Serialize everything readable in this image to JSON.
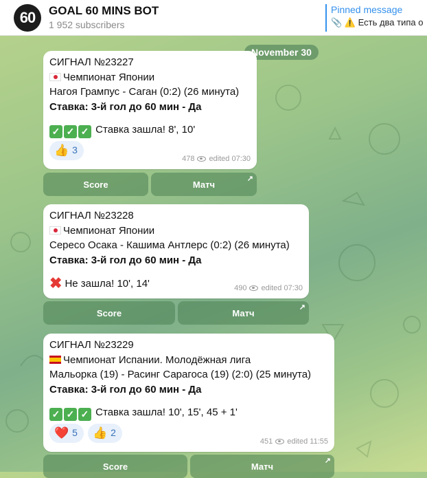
{
  "header": {
    "avatar_text": "60",
    "title": "GOAL 60 MINS BOT",
    "subscribers": "1 952 subscribers",
    "pinned_label": "Pinned message",
    "pinned_preview": "📎 ⚠️ Есть два типа о"
  },
  "date_label": "November 30",
  "messages": [
    {
      "title": "СИГНАЛ №23227",
      "league": "Чемпионат Японии",
      "flag": "jp",
      "match": "Нагоя Грампус - Саган (0:2) (26 минута)",
      "bet": "Ставка: 3-й гол до 60 мин - Да",
      "result_icon": "check-x3",
      "result": "Ставка зашла! 8', 10'",
      "reactions": [
        {
          "icon": "👍",
          "count": "3"
        }
      ],
      "views": "478",
      "edited": "edited 07:30",
      "buttons": {
        "score": "Score",
        "match": "Матч"
      }
    },
    {
      "title": "СИГНАЛ №23228",
      "league": "Чемпионат Японии",
      "flag": "jp",
      "match": "Сересо Осака - Кашима Антлерс (0:2) (26 минута)",
      "bet": "Ставка: 3-й гол до 60 мин - Да",
      "result_icon": "cross",
      "result": "Не зашла! 10', 14'",
      "reactions": [],
      "views": "490",
      "edited": "edited 07:30",
      "buttons": {
        "score": "Score",
        "match": "Матч"
      }
    },
    {
      "title": "СИГНАЛ №23229",
      "league": "Чемпионат Испании. Молодёжная лига",
      "flag": "es",
      "match": "Мальорка (19) - Расинг Сарагоса (19) (2:0) (25 минута)",
      "bet": "Ставка: 3-й гол до 60 мин - Да",
      "result_icon": "check-x3",
      "result": "Ставка зашла! 10', 15', 45 + 1'",
      "reactions": [
        {
          "icon": "❤️",
          "count": "5"
        },
        {
          "icon": "👍",
          "count": "2"
        }
      ],
      "views": "451",
      "edited": "edited 11:55",
      "buttons": {
        "score": "Score",
        "match": "Матч"
      }
    }
  ],
  "icons": {
    "check": "✓",
    "cross": "✖",
    "external_arrow": "↗"
  },
  "colors": {
    "accent": "#3390ec",
    "check_green": "#4caf50",
    "cross_red": "#e53935"
  }
}
